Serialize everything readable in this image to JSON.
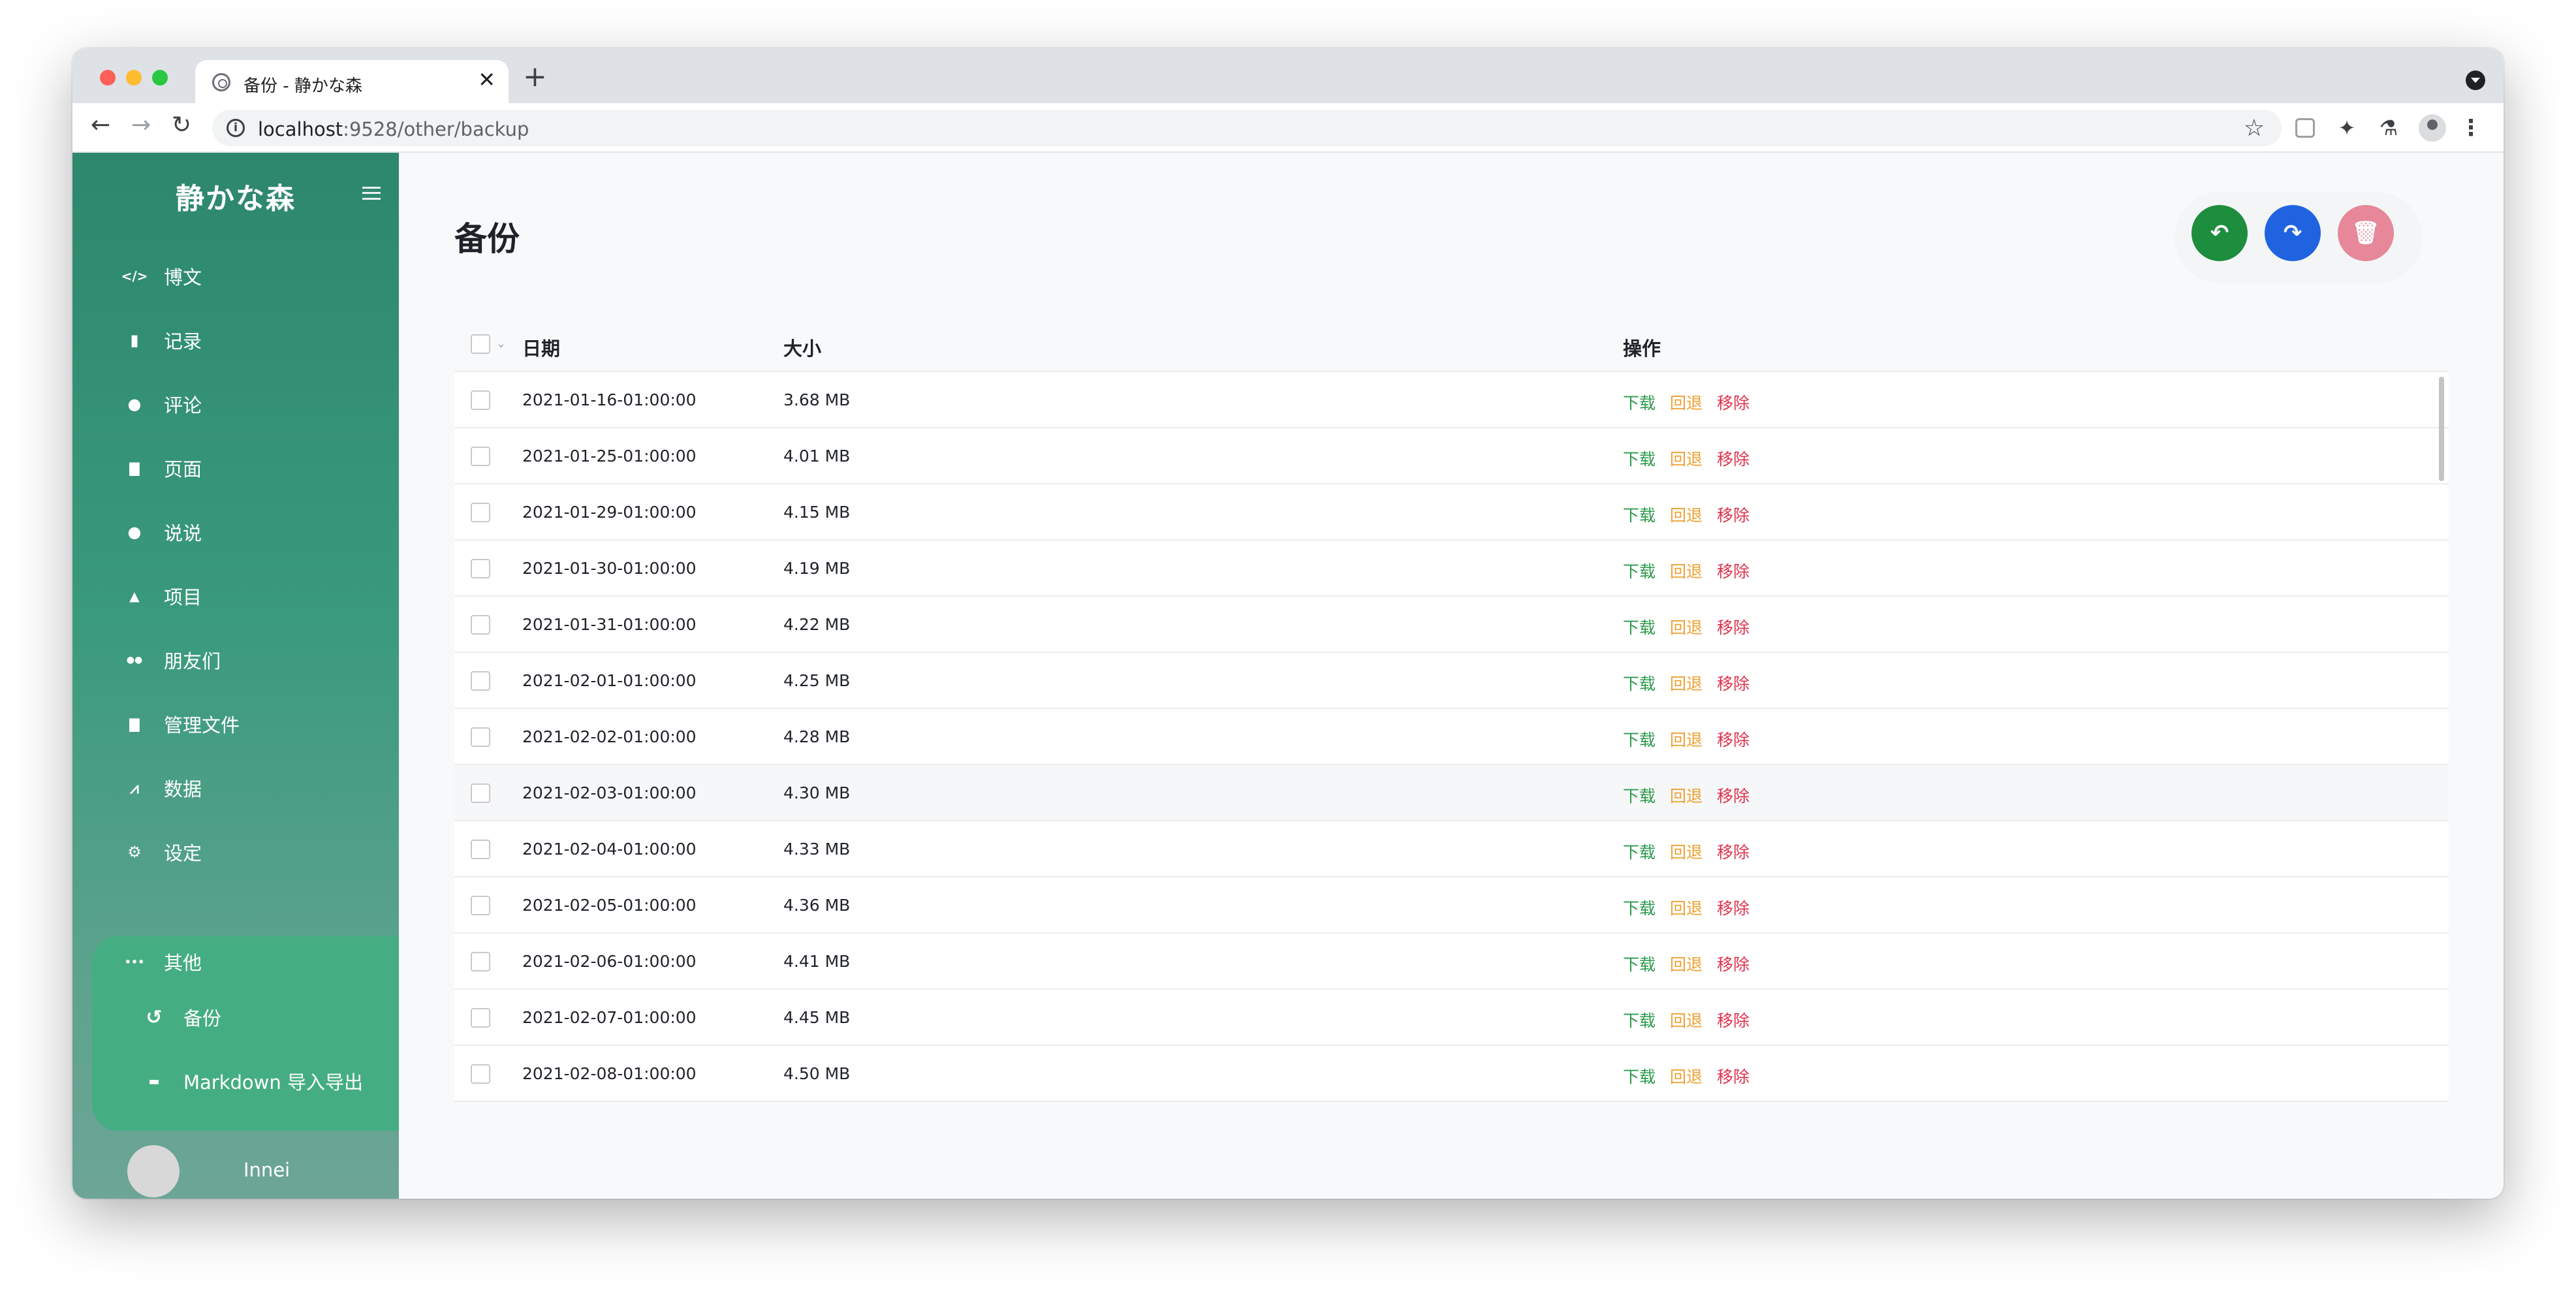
{
  "browser": {
    "tab_title": "备份 - 静かな森",
    "tab_close": "✕",
    "new_tab": "+",
    "url_host": "localhost",
    "url_path": ":9528/other/backup",
    "info_icon": "i"
  },
  "sidebar": {
    "brand": "静かな森",
    "items": [
      {
        "label": "博文",
        "icon": "code-icon",
        "glyph": "</>"
      },
      {
        "label": "记录",
        "icon": "book-icon",
        "glyph": "▮"
      },
      {
        "label": "评论",
        "icon": "comment-icon",
        "glyph": "●"
      },
      {
        "label": "页面",
        "icon": "file-icon",
        "glyph": "▇"
      },
      {
        "label": "说说",
        "icon": "comments-icon",
        "glyph": "●"
      },
      {
        "label": "项目",
        "icon": "flask-icon",
        "glyph": "▲"
      },
      {
        "label": "朋友们",
        "icon": "users-icon",
        "glyph": "●●"
      },
      {
        "label": "管理文件",
        "icon": "file-alt-icon",
        "glyph": "▇"
      },
      {
        "label": "数据",
        "icon": "chart-line-icon",
        "glyph": "⩘"
      },
      {
        "label": "设定",
        "icon": "cogs-icon",
        "glyph": "⚙"
      },
      {
        "label": "其他",
        "icon": "ellipsis-icon",
        "glyph": "•••"
      }
    ],
    "sub_items": [
      {
        "label": "备份",
        "icon": "undo-icon",
        "glyph": "↺"
      },
      {
        "label": "Markdown 导入导出",
        "icon": "markdown-icon",
        "glyph": "▬"
      }
    ],
    "user_name": "Innei"
  },
  "main": {
    "title": "备份",
    "actions": {
      "undo_glyph": "↶",
      "redo_glyph": "↷",
      "delete_glyph": "🗑"
    },
    "table": {
      "headers": {
        "date": "日期",
        "size": "大小",
        "ops": "操作"
      },
      "op_labels": {
        "download": "下载",
        "rollback": "回退",
        "remove": "移除"
      },
      "rows": [
        {
          "date": "2021-01-16-01:00:00",
          "size": "3.68 MB"
        },
        {
          "date": "2021-01-25-01:00:00",
          "size": "4.01 MB"
        },
        {
          "date": "2021-01-29-01:00:00",
          "size": "4.15 MB"
        },
        {
          "date": "2021-01-30-01:00:00",
          "size": "4.19 MB"
        },
        {
          "date": "2021-01-31-01:00:00",
          "size": "4.22 MB"
        },
        {
          "date": "2021-02-01-01:00:00",
          "size": "4.25 MB"
        },
        {
          "date": "2021-02-02-01:00:00",
          "size": "4.28 MB"
        },
        {
          "date": "2021-02-03-01:00:00",
          "size": "4.30 MB"
        },
        {
          "date": "2021-02-04-01:00:00",
          "size": "4.33 MB"
        },
        {
          "date": "2021-02-05-01:00:00",
          "size": "4.36 MB"
        },
        {
          "date": "2021-02-06-01:00:00",
          "size": "4.41 MB"
        },
        {
          "date": "2021-02-07-01:00:00",
          "size": "4.45 MB"
        },
        {
          "date": "2021-02-08-01:00:00",
          "size": "4.50 MB"
        }
      ]
    }
  },
  "colors": {
    "sidebar_top": "#2d876c",
    "sidebar_active": "#45ad82",
    "download": "#2b9a4a",
    "rollback": "#f0a030",
    "remove": "#e0334e",
    "fab_green": "#1d8d3e",
    "fab_blue": "#2063e0",
    "fab_pink": "#e68899"
  }
}
